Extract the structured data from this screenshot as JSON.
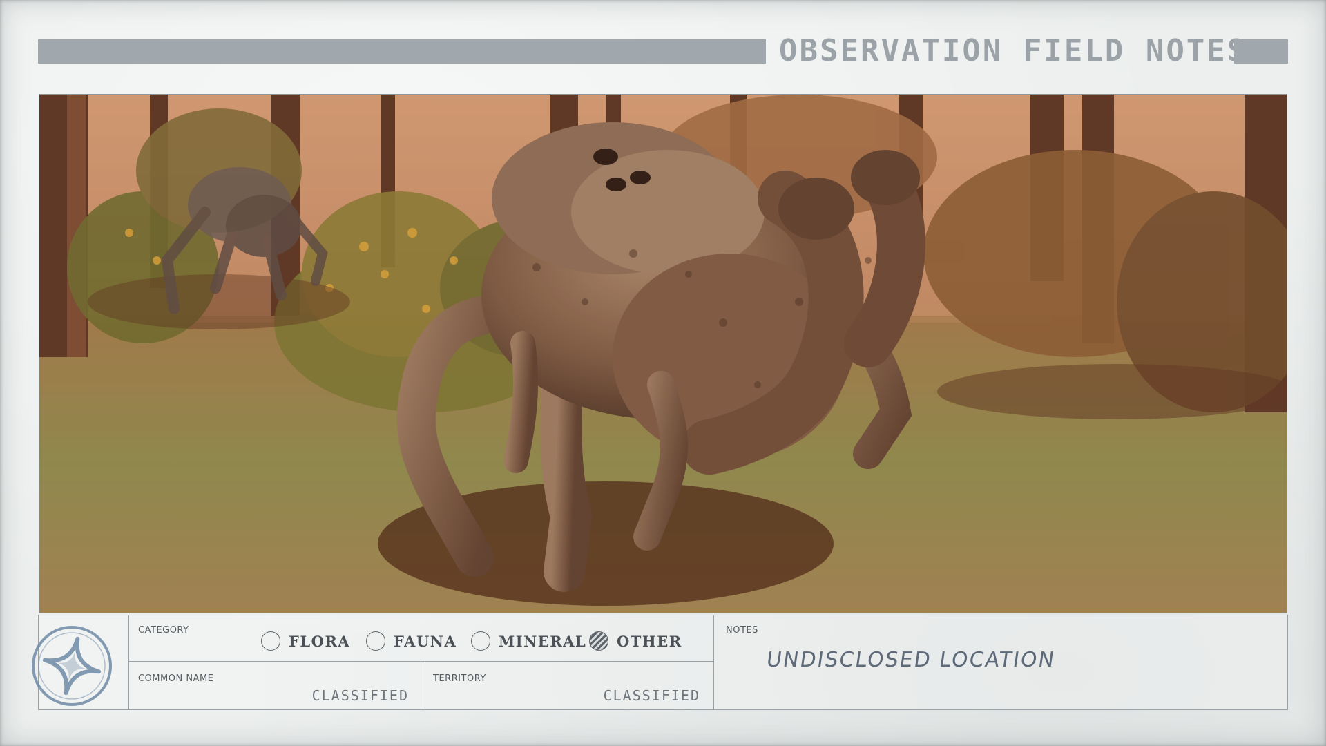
{
  "header": {
    "title": "OBSERVATION FIELD NOTES"
  },
  "photo": {
    "subject": "creature-photo"
  },
  "form": {
    "category": {
      "label": "CATEGORY",
      "options": [
        {
          "label": "FLORA",
          "selected": false
        },
        {
          "label": "FAUNA",
          "selected": false
        },
        {
          "label": "MINERAL",
          "selected": false
        },
        {
          "label": "OTHER",
          "selected": true
        }
      ]
    },
    "common_name": {
      "label": "COMMON NAME",
      "value": "CLASSIFIED"
    },
    "territory": {
      "label": "TERRITORY",
      "value": "CLASSIFIED"
    },
    "notes": {
      "label": "NOTES",
      "value": "UNDISCLOSED LOCATION"
    },
    "seal_icon": "star-compass-seal-icon"
  },
  "colors": {
    "paper": "#ecefee",
    "header_bar": "#a1a8ad",
    "ink": "#4b5156",
    "handwriting": "#5e6a7a",
    "seal": "#6f8aa6"
  }
}
